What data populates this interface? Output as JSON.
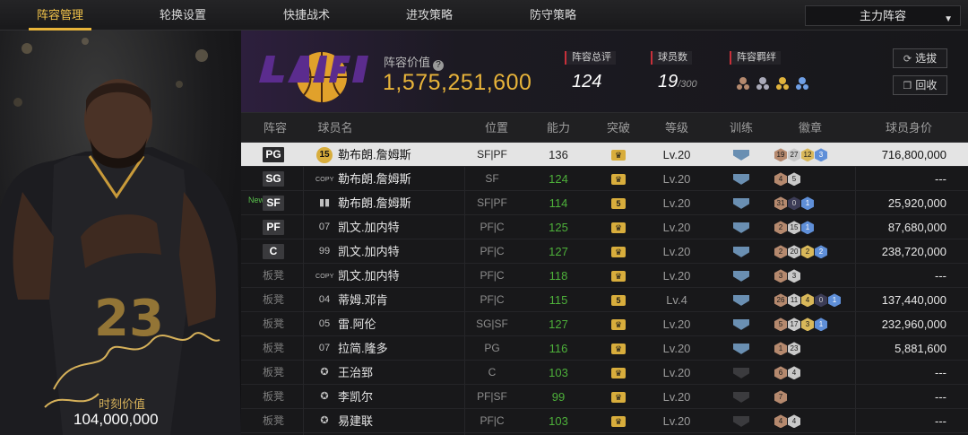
{
  "tabs": [
    {
      "label": "阵容管理",
      "active": true
    },
    {
      "label": "轮换设置",
      "active": false
    },
    {
      "label": "快捷战术",
      "active": false
    },
    {
      "label": "进攻策略",
      "active": false
    },
    {
      "label": "防守策略",
      "active": false
    }
  ],
  "lineup_select": {
    "value": "主力阵容"
  },
  "portrait": {
    "value_label": "时刻价值",
    "value": "104,000,000"
  },
  "summary": {
    "value_label": "阵容价值",
    "value": "1,575,251,600",
    "rating_label": "阵容总评",
    "rating": "124",
    "count_label": "球员数",
    "count": "19",
    "count_max": "/300",
    "bond_label": "阵容羁绊"
  },
  "buttons": {
    "pick": "选拔",
    "recycle": "回收"
  },
  "columns": {
    "lineup": "阵容",
    "name": "球员名",
    "position": "位置",
    "ability": "能力",
    "breakthrough": "突破",
    "level": "等级",
    "training": "训练",
    "badges": "徽章",
    "worth": "球员身价"
  },
  "colors": {
    "accent": "#e8b43a",
    "ability_green": "#4db03a",
    "bond_red": "#c8303a",
    "badge_blue": "#5f8fd8"
  },
  "players": [
    {
      "slot": "PG",
      "num": "15",
      "name": "勒布朗.詹姆斯",
      "position": "SF|PF",
      "ability": "136",
      "brk": "crown",
      "level": "Lv.20",
      "train": "on",
      "badges": [
        {
          "t": "b",
          "v": "19"
        },
        {
          "t": "s",
          "v": "27"
        },
        {
          "t": "g",
          "v": "12"
        },
        {
          "t": "h",
          "v": "3"
        }
      ],
      "worth": "716,800,000",
      "selected": true
    },
    {
      "slot": "SG",
      "num": "COPY",
      "name": "勒布朗.詹姆斯",
      "position": "SF",
      "ability": "124",
      "brk": "crown",
      "level": "Lv.20",
      "train": "on",
      "badges": [
        {
          "t": "b",
          "v": "4"
        },
        {
          "t": "s",
          "v": "5"
        }
      ],
      "worth": "---"
    },
    {
      "slot": "SF",
      "new": "New",
      "num": "bars",
      "name": "勒布朗.詹姆斯",
      "position": "SF|PF",
      "ability": "114",
      "brk": "5",
      "level": "Lv.20",
      "train": "on",
      "badges": [
        {
          "t": "b",
          "v": "31"
        },
        {
          "t": "d",
          "v": "0"
        },
        {
          "t": "h",
          "v": "1"
        }
      ],
      "worth": "25,920,000"
    },
    {
      "slot": "PF",
      "num": "07",
      "name": "凯文.加内特",
      "position": "PF|C",
      "ability": "125",
      "brk": "crown",
      "level": "Lv.20",
      "train": "on",
      "badges": [
        {
          "t": "b",
          "v": "2"
        },
        {
          "t": "s",
          "v": "15"
        },
        {
          "t": "h",
          "v": "1"
        }
      ],
      "worth": "87,680,000"
    },
    {
      "slot": "C",
      "num": "99",
      "name": "凯文.加内特",
      "position": "PF|C",
      "ability": "127",
      "brk": "crown",
      "level": "Lv.20",
      "train": "on",
      "badges": [
        {
          "t": "b",
          "v": "2"
        },
        {
          "t": "s",
          "v": "20"
        },
        {
          "t": "g",
          "v": "2"
        },
        {
          "t": "h",
          "v": "2"
        }
      ],
      "worth": "238,720,000"
    },
    {
      "slot": "板凳",
      "num": "COPY",
      "name": "凯文.加内特",
      "position": "PF|C",
      "ability": "118",
      "brk": "crown",
      "level": "Lv.20",
      "train": "on",
      "badges": [
        {
          "t": "b",
          "v": "3"
        },
        {
          "t": "s",
          "v": "3"
        }
      ],
      "worth": "---"
    },
    {
      "slot": "板凳",
      "num": "04",
      "name": "蒂姆.邓肯",
      "position": "PF|C",
      "ability": "115",
      "brk": "5",
      "level": "Lv.4",
      "train": "on",
      "badges": [
        {
          "t": "b",
          "v": "26"
        },
        {
          "t": "s",
          "v": "11"
        },
        {
          "t": "g",
          "v": "4"
        },
        {
          "t": "d",
          "v": "0"
        },
        {
          "t": "h",
          "v": "1"
        }
      ],
      "worth": "137,440,000"
    },
    {
      "slot": "板凳",
      "num": "05",
      "name": "雷.阿伦",
      "position": "SG|SF",
      "ability": "127",
      "brk": "crown",
      "level": "Lv.20",
      "train": "on",
      "badges": [
        {
          "t": "b",
          "v": "5"
        },
        {
          "t": "s",
          "v": "17"
        },
        {
          "t": "g",
          "v": "3"
        },
        {
          "t": "h",
          "v": "1"
        }
      ],
      "worth": "232,960,000"
    },
    {
      "slot": "板凳",
      "num": "07",
      "name": "拉简.隆多",
      "position": "PG",
      "ability": "116",
      "brk": "crown",
      "level": "Lv.20",
      "train": "on",
      "badges": [
        {
          "t": "b",
          "v": "1"
        },
        {
          "t": "s",
          "v": "23"
        }
      ],
      "worth": "5,881,600"
    },
    {
      "slot": "板凳",
      "num": "star",
      "name": "王治郅",
      "position": "C",
      "ability": "103",
      "brk": "crown",
      "level": "Lv.20",
      "train": "off",
      "badges": [
        {
          "t": "b",
          "v": "6"
        },
        {
          "t": "s",
          "v": "4"
        }
      ],
      "worth": "---"
    },
    {
      "slot": "板凳",
      "num": "star",
      "name": "李凯尔",
      "position": "PF|SF",
      "ability": "99",
      "brk": "crown",
      "level": "Lv.20",
      "train": "off",
      "badges": [
        {
          "t": "b",
          "v": "7"
        }
      ],
      "worth": "---"
    },
    {
      "slot": "板凳",
      "num": "star",
      "name": "易建联",
      "position": "PF|C",
      "ability": "103",
      "brk": "crown",
      "level": "Lv.20",
      "train": "off",
      "badges": [
        {
          "t": "b",
          "v": "4"
        },
        {
          "t": "s",
          "v": "4"
        }
      ],
      "worth": "---"
    }
  ]
}
